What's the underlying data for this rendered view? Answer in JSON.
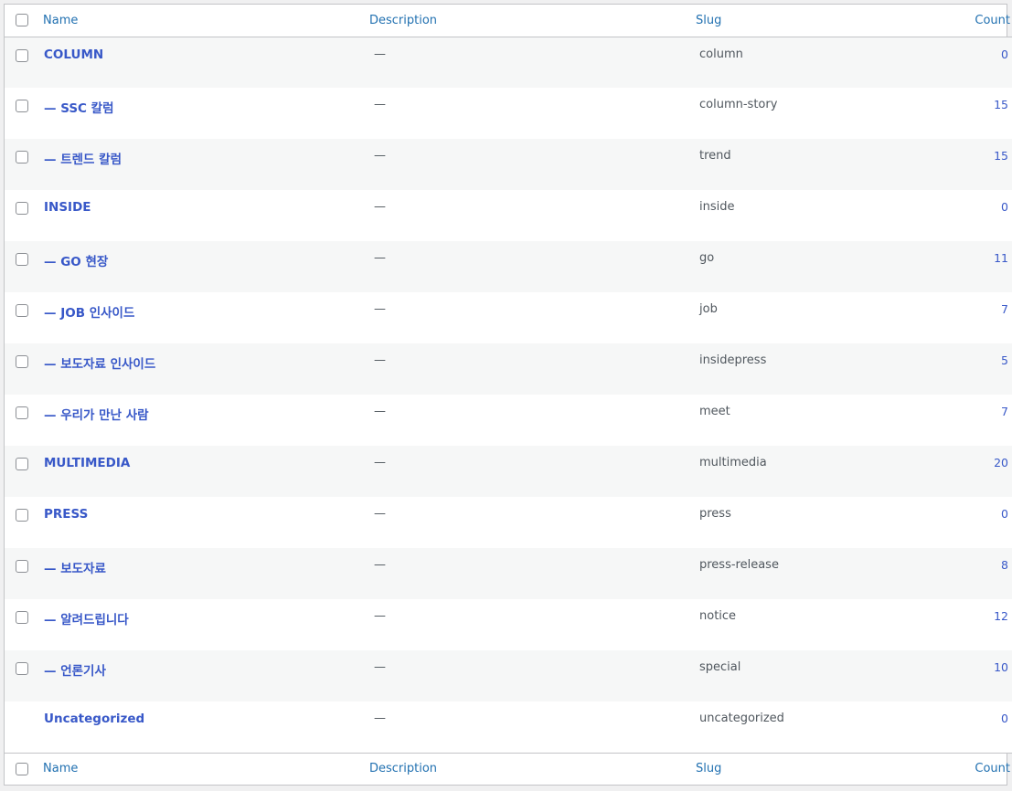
{
  "headers": {
    "name": "Name",
    "description": "Description",
    "slug": "Slug",
    "count": "Count"
  },
  "rows": [
    {
      "name": "COLUMN",
      "description": "—",
      "slug": "column",
      "count": "0"
    },
    {
      "name": "— SSC 칼럼",
      "description": "—",
      "slug": "column-story",
      "count": "15"
    },
    {
      "name": "— 트렌드 칼럼",
      "description": "—",
      "slug": "trend",
      "count": "15"
    },
    {
      "name": "INSIDE",
      "description": "—",
      "slug": "inside",
      "count": "0"
    },
    {
      "name": "— GO 현장",
      "description": "—",
      "slug": "go",
      "count": "11"
    },
    {
      "name": "— JOB 인사이드",
      "description": "—",
      "slug": "job",
      "count": "7"
    },
    {
      "name": "— 보도자료 인사이드",
      "description": "—",
      "slug": "insidepress",
      "count": "5"
    },
    {
      "name": "— 우리가 만난 사람",
      "description": "—",
      "slug": "meet",
      "count": "7"
    },
    {
      "name": "MULTIMEDIA",
      "description": "—",
      "slug": "multimedia",
      "count": "20"
    },
    {
      "name": "PRESS",
      "description": "—",
      "slug": "press",
      "count": "0"
    },
    {
      "name": "— 보도자료",
      "description": "—",
      "slug": "press-release",
      "count": "8"
    },
    {
      "name": "— 알려드립니다",
      "description": "—",
      "slug": "notice",
      "count": "12"
    },
    {
      "name": "— 언론기사",
      "description": "—",
      "slug": "special",
      "count": "10"
    },
    {
      "name": "Uncategorized",
      "description": "—",
      "slug": "uncategorized",
      "count": "0"
    }
  ]
}
